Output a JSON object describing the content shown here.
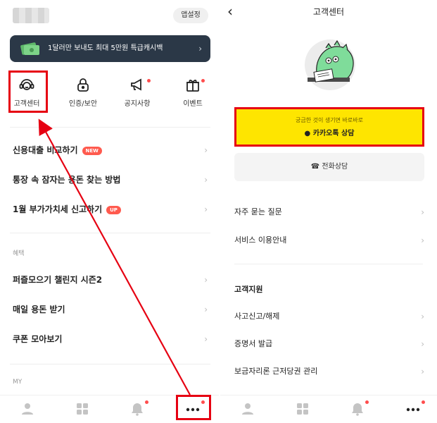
{
  "left": {
    "app_settings": "앱설정",
    "banner": {
      "text": "1달러만 보내도 최대 5만원 특급캐시백",
      "chevron": "›"
    },
    "quick_menu": [
      {
        "label": "고객센터",
        "icon": "headset-smile-icon"
      },
      {
        "label": "인증/보안",
        "icon": "lock-icon"
      },
      {
        "label": "공지사항",
        "icon": "megaphone-icon"
      },
      {
        "label": "이벤트",
        "icon": "gift-icon"
      }
    ],
    "menu": [
      {
        "label": "신용대출 비교하기",
        "badge": "NEW"
      },
      {
        "label": "통장 속 잠자는 용돈 찾는 방법",
        "badge": ""
      },
      {
        "label": "1월 부가가치세 신고하기",
        "badge": "UP"
      }
    ],
    "benefits_section": "혜택",
    "benefits": [
      {
        "label": "퍼즐모으기 챌린지 시즌2"
      },
      {
        "label": "매일 용돈 받기"
      },
      {
        "label": "쿠폰 모아보기"
      }
    ],
    "my_section": "MY",
    "chevron": "›"
  },
  "right": {
    "title": "고객센터",
    "back": "‹",
    "kakao": {
      "sub": "궁금한 것이 생기면 바로바로",
      "main": "카카오톡 상담"
    },
    "phone": "전화상담",
    "faq_rows": [
      {
        "label": "자주 묻는 질문"
      },
      {
        "label": "서비스 이용안내"
      }
    ],
    "support_section": "고객지원",
    "support_rows": [
      {
        "label": "사고신고/해제"
      },
      {
        "label": "증명서 발급"
      },
      {
        "label": "보금자리론 근저당권 관리"
      }
    ],
    "chevron": "›"
  },
  "colors": {
    "highlight": "#e60012",
    "kakao_yellow": "#fee500",
    "banner_bg": "#2b3847",
    "badge_red": "#ff5a4e"
  }
}
